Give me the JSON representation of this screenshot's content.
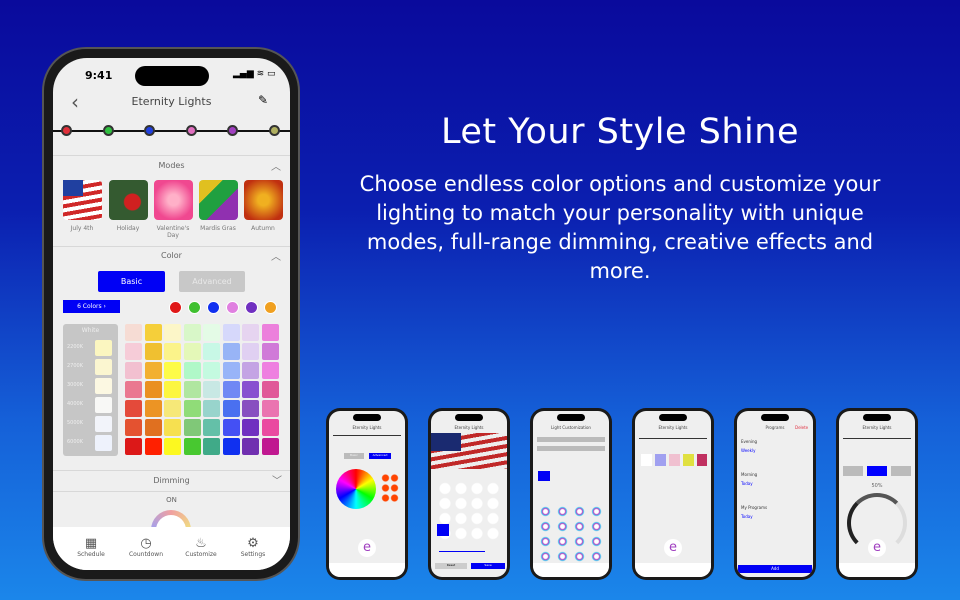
{
  "hero": {
    "headline": "Let Your Style Shine",
    "body": "Choose endless color options and customize your lighting to match your personality with unique modes, full-range dimming, creative effects and more."
  },
  "phone": {
    "status_time": "9:41",
    "title": "Eternity Lights",
    "bulbs": [
      "#e0303a",
      "#30c040",
      "#2040e0",
      "#e070c0",
      "#a040c0",
      "#b0b060"
    ],
    "modes": {
      "header": "Modes",
      "items": [
        {
          "label": "July 4th"
        },
        {
          "label": "Holiday"
        },
        {
          "label": "Valentine's Day"
        },
        {
          "label": "Mardis Gras"
        },
        {
          "label": "Autumn"
        }
      ]
    },
    "color": {
      "header": "Color",
      "basic": "Basic",
      "advanced": "Advanced",
      "colors_tag": "6 Colors",
      "selected_colors": [
        "#e01818",
        "#40c030",
        "#1030f0",
        "#e080e0",
        "#7030c0",
        "#f0a020"
      ],
      "white_label": "White",
      "whites": [
        "2200K",
        "2700K",
        "3000K",
        "4000K",
        "5000K",
        "6000K"
      ],
      "grid": [
        [
          "#f6dcd4",
          "#f5cf3a",
          "#fcf6c8",
          "#d8f7c8",
          "#e4fbe6",
          "#d6d8fb",
          "#e6d4f0",
          "#ec80dc"
        ],
        [
          "#f6ccd8",
          "#f0c030",
          "#fbf38a",
          "#e4f8b8",
          "#c8f8e6",
          "#98b4f6",
          "#e0d0f2",
          "#d07ad8"
        ],
        [
          "#f2c0d0",
          "#f2b030",
          "#fdfb48",
          "#b0f8c8",
          "#c4fae0",
          "#98b4f8",
          "#c4a4e4",
          "#ee80e0"
        ],
        [
          "#ea7890",
          "#ea9020",
          "#fcf640",
          "#b0e6a0",
          "#c8e8e4",
          "#7088f4",
          "#8850d0",
          "#e05898"
        ],
        [
          "#e44a3a",
          "#ec9424",
          "#f6e878",
          "#90dc78",
          "#98d4cc",
          "#4a70f0",
          "#8850c0",
          "#ea74b0"
        ],
        [
          "#e45230",
          "#e07020",
          "#f6e050",
          "#80c878",
          "#64c0a8",
          "#4450f4",
          "#7030c0",
          "#ea4aa0"
        ],
        [
          "#dc1818",
          "#ff2000",
          "#fcf820",
          "#48c830",
          "#40aa88",
          "#1030f0",
          "#7030b0",
          "#c01890"
        ]
      ]
    },
    "dimming": {
      "header": "Dimming",
      "state": "ON"
    },
    "tabs": [
      "Schedule",
      "Countdown",
      "Customize",
      "Settings"
    ]
  },
  "minis": [
    {
      "title": "Eternity Lights",
      "basic": "Basic",
      "advanced": "Advanced"
    },
    {
      "title": "Eternity Lights",
      "reset": "Reset",
      "save": "Save"
    },
    {
      "title": "Light Customization"
    },
    {
      "title": "Eternity Lights"
    },
    {
      "title": "Programs",
      "delete": "Delete",
      "sections": [
        "Evening",
        "Weekly",
        "Morning",
        "Today",
        "My Programs",
        "Today"
      ],
      "add": "Add"
    },
    {
      "title": "Eternity Lights",
      "percent": "50%"
    }
  ],
  "accent": "#0000f5"
}
